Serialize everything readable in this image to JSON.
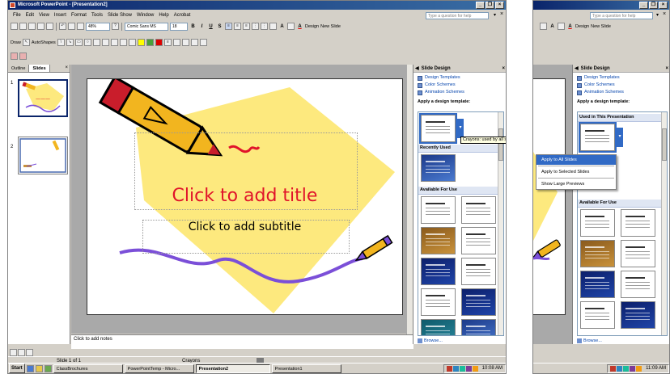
{
  "window1": {
    "title": "Microsoft PowerPoint - [Presentation2]",
    "menus": [
      "File",
      "Edit",
      "View",
      "Insert",
      "Format",
      "Tools",
      "Slide Show",
      "Window",
      "Help",
      "Acrobat"
    ],
    "question_box": "Type a question for help",
    "toolbar": {
      "zoom": "48%",
      "font": "Comic Sans MS",
      "font_size": "18",
      "bold": "B",
      "italic": "I",
      "underline": "U",
      "shadow": "S",
      "grow_font": "A",
      "font_color": "A",
      "design": "Design",
      "new_slide": "New Slide"
    },
    "drawing": {
      "draw": "Draw",
      "autoshapes": "AutoShapes"
    },
    "tabs": {
      "outline": "Outline",
      "slides": "Slides",
      "close": "×"
    },
    "thumbnails": [
      {
        "number": "1"
      },
      {
        "number": "2"
      }
    ],
    "slide": {
      "title_placeholder": "Click to add title",
      "subtitle_placeholder": "Click to add subtitle"
    },
    "notes": "Click to add notes",
    "status": {
      "slide": "Slide 1 of 1",
      "design": "Crayons"
    },
    "task_pane": {
      "title": "Slide Design",
      "close": "×",
      "links": [
        "Design Templates",
        "Color Schemes",
        "Animation Schemes"
      ],
      "apply_label": "Apply a design template:",
      "tooltip": "Crayons: used by all slides",
      "recently_used": "Recently Used",
      "available": "Available For Use",
      "browse": "Browse..."
    },
    "taskbar": {
      "start": "Start",
      "tasks": [
        "ClassBrochures",
        "PowerPointTemp - Micro...",
        "Presentation2",
        "Presentation1"
      ],
      "clock": "10:08 AM"
    }
  },
  "window2": {
    "question_box": "Type a question for help",
    "toolbar": {
      "grow_font": "A",
      "font_color": "A",
      "design": "Design",
      "new_slide": "New Slide"
    },
    "task_pane": {
      "title": "Slide Design",
      "close": "×",
      "links": [
        "Design Templates",
        "Color Schemes",
        "Animation Schemes"
      ],
      "apply_label": "Apply a design template:",
      "used_section": "Used in This Presentation",
      "available": "Available For Use",
      "browse": "Browse..."
    },
    "context_menu": [
      "Apply to All Slides",
      "Apply to Selected Slides",
      "Show Large Previews"
    ],
    "taskbar": {
      "clock": "11:09 AM"
    }
  },
  "colors": {
    "title_red": "#e0132a",
    "selection_blue": "#316ac5",
    "titlebar_blue": "#0a246a",
    "yellow_shape": "#fde97e",
    "purple_line": "#7b4fd8"
  }
}
